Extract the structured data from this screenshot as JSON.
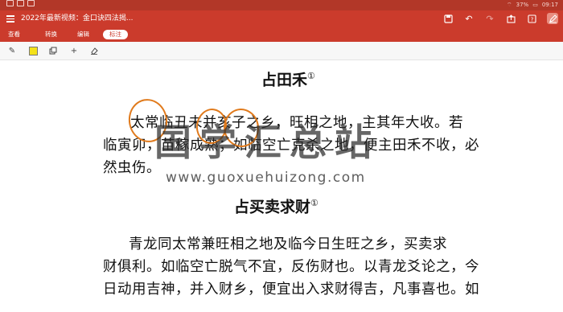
{
  "status_bar": {
    "left_icons": [
      "signal-icon",
      "image-icon",
      "notification-icon"
    ],
    "battery": "37%",
    "time": "09:17"
  },
  "titlebar": {
    "title": "2022年最新视频：金口诀四法揭...",
    "actions": [
      "save-icon",
      "undo-icon",
      "redo-icon",
      "share-icon",
      "help-icon",
      "annotate-icon"
    ]
  },
  "tabs": [
    {
      "label": "查看",
      "active": false
    },
    {
      "label": "转换",
      "active": false
    },
    {
      "label": "编辑",
      "active": false
    },
    {
      "label": "标注",
      "active": true
    }
  ],
  "annotation_tools": [
    "pen-icon",
    "highlight-icon",
    "copy-icon",
    "add-icon",
    "eraser-icon"
  ],
  "document": {
    "heading1": "占田禾",
    "heading1_note": "①",
    "para1": [
      "太常临丑未并亥子之乡，旺相之地，主其年大收。若",
      "临寅卯，苗稼成熟；如临空亡克杀之地，便主田禾不收，必",
      "然虫伤。"
    ],
    "heading2": "占买卖求财",
    "heading2_note": "①",
    "para2": [
      "青龙同太常兼旺相之地及临今日生旺之乡，买卖求",
      "财俱利。如临空亡脱气不宜，反伤财也。以青龙爻论之，今",
      "日动用吉神，并入财乡，便宜出入求财得吉，凡事喜也。如"
    ]
  },
  "watermark": {
    "text": "国学汇总站",
    "url": "www.guoxuehuizong.com"
  },
  "colors": {
    "brand_red": "#cb3b2c",
    "status_red": "#b23728",
    "ink_circle": "#e07a1c"
  }
}
